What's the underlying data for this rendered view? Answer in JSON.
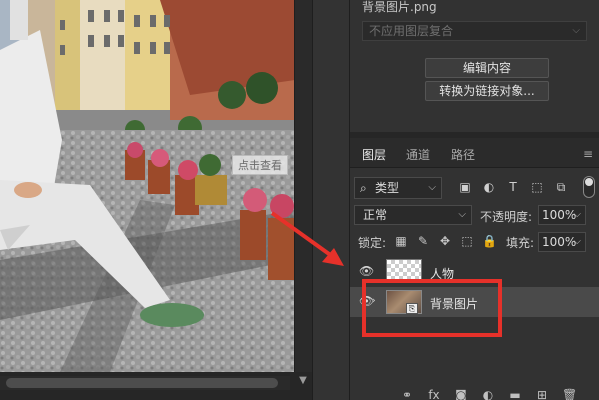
{
  "canvas": {
    "overlay_label": "点击查看"
  },
  "properties": {
    "file_title": "背景图片.png",
    "comp_select_placeholder": "不应用图层复合",
    "edit_contents_label": "编辑内容",
    "convert_link_label": "转换为链接对象..."
  },
  "layers_panel": {
    "tabs": [
      {
        "label": "图层",
        "active": true
      },
      {
        "label": "通道",
        "active": false
      },
      {
        "label": "路径",
        "active": false
      }
    ],
    "filter_label": "类型",
    "blend_mode": "正常",
    "opacity_label": "不透明度:",
    "opacity_value": "100%",
    "lock_label": "锁定:",
    "fill_label": "填充:",
    "fill_value": "100%",
    "layers": [
      {
        "name": "人物",
        "visible": true,
        "type": "transparent",
        "selected": false
      },
      {
        "name": "背景图片",
        "visible": true,
        "type": "smart-object",
        "selected": true
      }
    ]
  },
  "icons": {
    "search": "⌕",
    "eye": "👁",
    "menu": "≡",
    "chevron_down": "⌵",
    "scroll_down": "▼",
    "filter_image": "▣",
    "filter_adjust": "◐",
    "filter_text": "T",
    "filter_shape": "⬚",
    "filter_smart": "⧉",
    "lock_pixels_transparent": "▦",
    "lock_brush": "✎",
    "lock_move": "✥",
    "lock_artboard": "⬚",
    "lock_all": "🔒",
    "link": "⚭",
    "fx": "fx",
    "mask": "◙",
    "adjustment": "◐",
    "group": "▬",
    "new_layer": "⊞",
    "delete": "🗑"
  },
  "colors": {
    "highlight": "#e6312a",
    "panel_bg": "#323232",
    "selected_row": "#4a4a4a"
  }
}
